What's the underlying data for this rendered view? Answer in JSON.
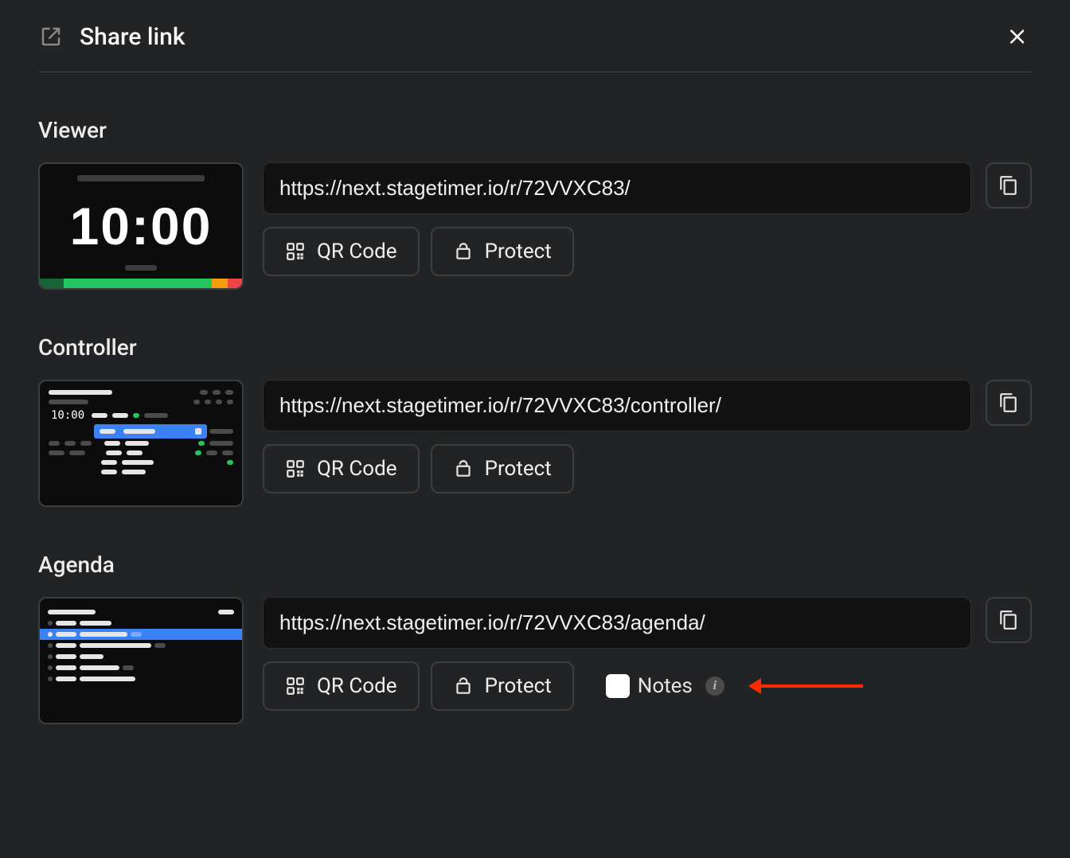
{
  "header": {
    "title": "Share link"
  },
  "viewer": {
    "heading": "Viewer",
    "url": "https://next.stagetimer.io/r/72VVXC83/",
    "qr_label": "QR Code",
    "protect_label": "Protect",
    "thumb_time": "10:00"
  },
  "controller": {
    "heading": "Controller",
    "url": "https://next.stagetimer.io/r/72VVXC83/controller/",
    "qr_label": "QR Code",
    "protect_label": "Protect",
    "thumb_time": "10:00"
  },
  "agenda": {
    "heading": "Agenda",
    "url": "https://next.stagetimer.io/r/72VVXC83/agenda/",
    "qr_label": "QR Code",
    "protect_label": "Protect",
    "notes_label": "Notes"
  }
}
